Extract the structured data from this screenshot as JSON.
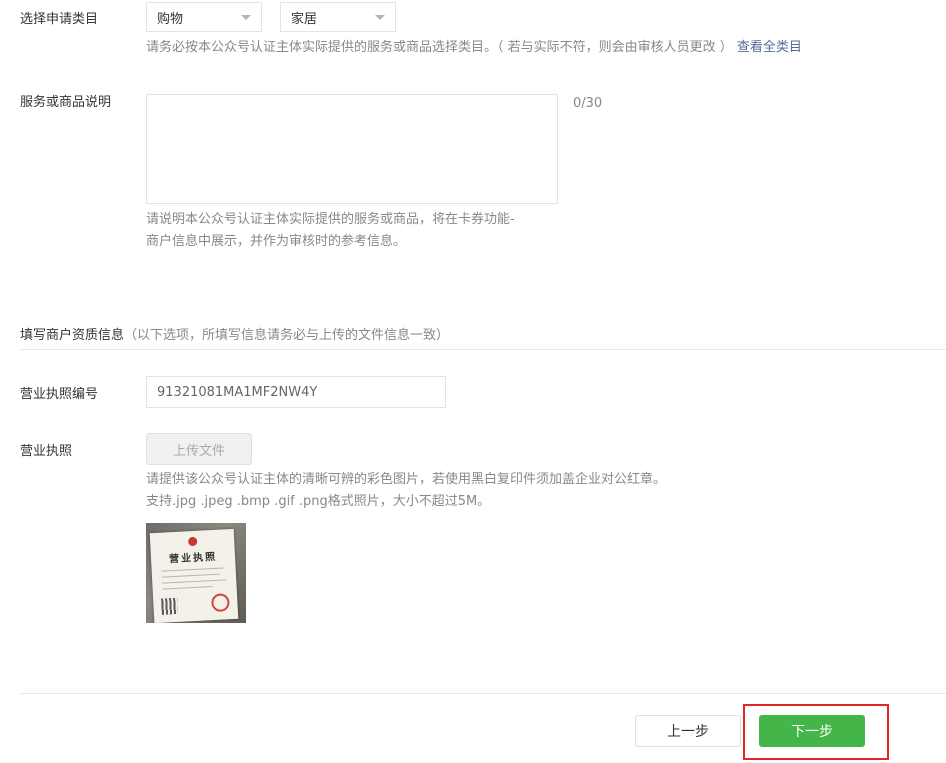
{
  "category": {
    "label": "选择申请类目",
    "primary_value": "购物",
    "secondary_value": "家居",
    "hint": "请务必按本公众号认证主体实际提供的服务或商品选择类目。（ 若与实际不符，则会由审核人员更改 ）",
    "view_all_link": "查看全类目"
  },
  "description": {
    "label": "服务或商品说明",
    "value": "",
    "counter": "0/30",
    "hint_line1": "请说明本公众号认证主体实际提供的服务或商品，将在卡券功能-",
    "hint_line2": "商户信息中展示，并作为审核时的参考信息。"
  },
  "qualification": {
    "title": "填写商户资质信息",
    "subtitle": "（以下选项，所填写信息请务必与上传的文件信息一致）"
  },
  "license_number": {
    "label": "营业执照编号",
    "value": "91321081MA1MF2NW4Y"
  },
  "license": {
    "label": "营业执照",
    "upload_label": "上传文件",
    "hint_line1": "请提供该公众号认证主体的清晰可辨的彩色图片，若使用黑白复印件须加盖企业对公红章。",
    "hint_line2": "支持.jpg .jpeg .bmp .gif .png格式照片，大小不超过5M。",
    "thumbnail_title": "营业执照"
  },
  "footer": {
    "prev_label": "上一步",
    "next_label": "下一步"
  },
  "colors": {
    "primary_green": "#44b549",
    "link_blue": "#576b95",
    "highlight_red": "#e02727",
    "hint_gray": "#888888"
  }
}
